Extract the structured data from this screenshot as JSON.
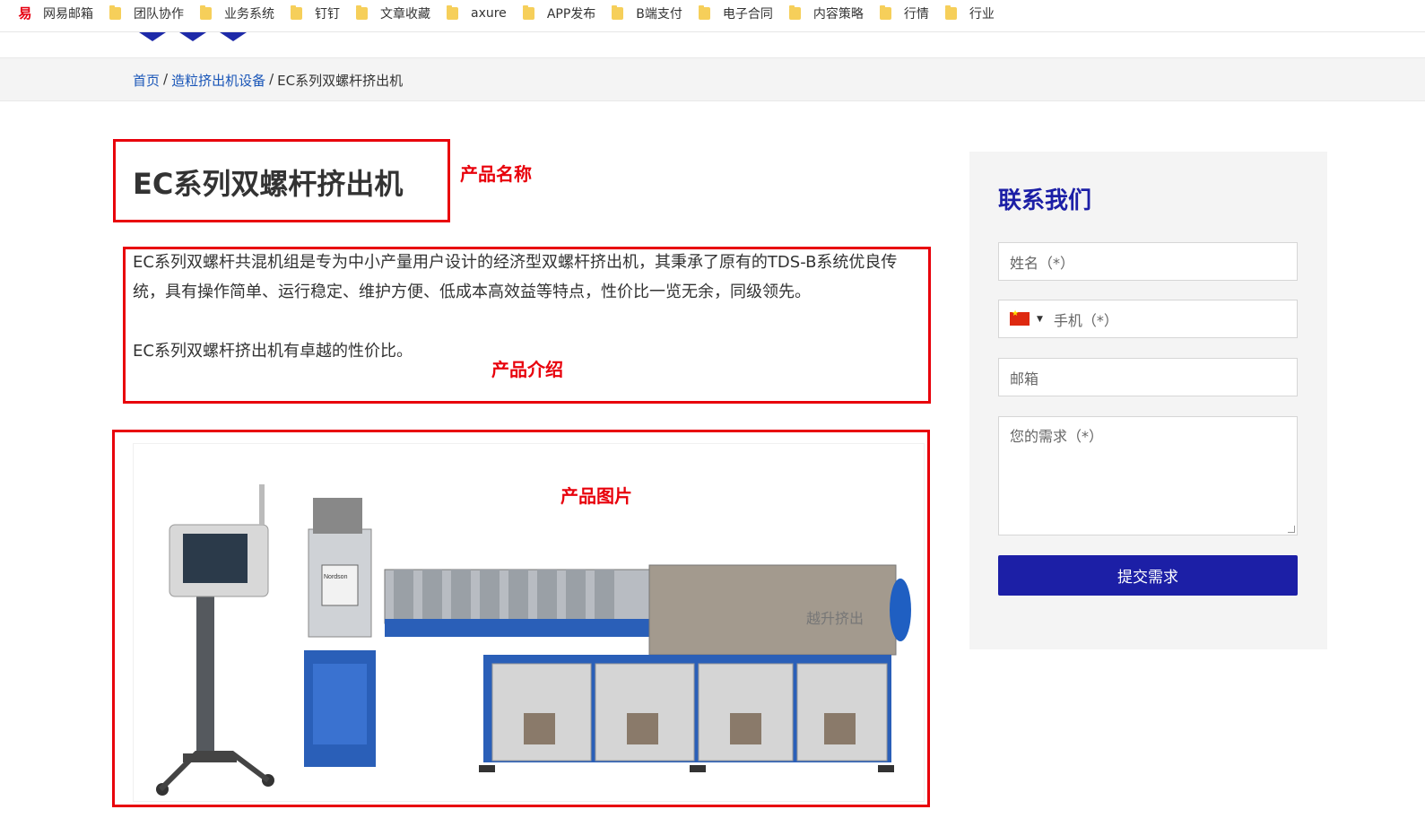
{
  "bookmarks": [
    {
      "label": "网易邮箱",
      "icon": "netease-mail-icon"
    },
    {
      "label": "团队协作",
      "icon": "folder-icon"
    },
    {
      "label": "业务系统",
      "icon": "folder-icon"
    },
    {
      "label": "钉钉",
      "icon": "folder-icon"
    },
    {
      "label": "文章收藏",
      "icon": "folder-icon"
    },
    {
      "label": "axure",
      "icon": "folder-icon"
    },
    {
      "label": "APP发布",
      "icon": "folder-icon"
    },
    {
      "label": "B端支付",
      "icon": "folder-icon"
    },
    {
      "label": "电子合同",
      "icon": "folder-icon"
    },
    {
      "label": "内容策略",
      "icon": "folder-icon"
    },
    {
      "label": "行情",
      "icon": "folder-icon"
    },
    {
      "label": "行业",
      "icon": "folder-icon"
    }
  ],
  "breadcrumb": {
    "home": "首页",
    "sep1": "/",
    "category": "造粒挤出机设备",
    "sep2": "/",
    "current": "EC系列双螺杆挤出机"
  },
  "product": {
    "title": "EC系列双螺杆挤出机",
    "desc_p1": "EC系列双螺杆共混机组是专为中小产量用户设计的经济型双螺杆挤出机，其秉承了原有的TDS-B系统优良传统，具有操作简单、运行稳定、维护方便、低成本高效益等特点，性价比一览无余，同级领先。",
    "desc_p2": "EC系列双螺杆挤出机有卓越的性价比。",
    "image_watermark": "越升挤出",
    "extruder_badge": "Nordson"
  },
  "annotations": {
    "name": "产品名称",
    "intro": "产品介绍",
    "image": "产品图片"
  },
  "contact": {
    "title": "联系我们",
    "name_placeholder": "姓名（*）",
    "phone_placeholder": "手机（*）",
    "email_placeholder": "邮箱",
    "needs_placeholder": "您的需求（*）",
    "submit_label": "提交需求"
  },
  "colors": {
    "accent": "#1c1fa6",
    "annotation": "#e8000b",
    "link": "#1a56b8"
  }
}
